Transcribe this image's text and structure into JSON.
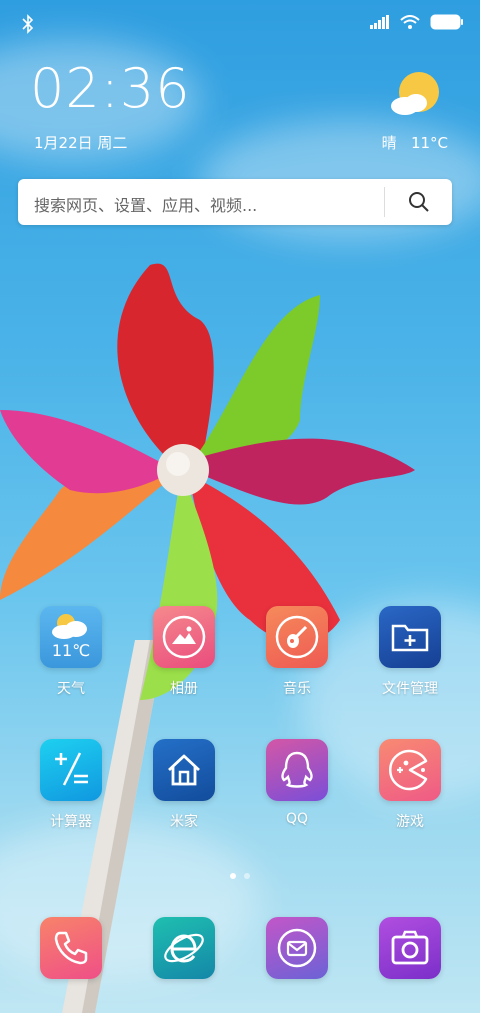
{
  "status_bar": {
    "bluetooth": "bluetooth-icon",
    "signal": "signal-icon",
    "wifi": "wifi-icon",
    "battery": "battery-icon"
  },
  "clock": {
    "time": "02:36",
    "date": "1月22日 周二"
  },
  "weather": {
    "condition": "晴",
    "temperature": "11°C",
    "icon": "sun-cloud-icon"
  },
  "search": {
    "placeholder": "搜索网页、设置、应用、视频..."
  },
  "apps_row1": [
    {
      "label": "天气",
      "icon": "weather-icon",
      "icon_text": "11℃",
      "color": "#4aa8e6"
    },
    {
      "label": "相册",
      "icon": "gallery-icon",
      "color": "#f0607c"
    },
    {
      "label": "音乐",
      "icon": "music-icon",
      "color": "#f26a56"
    },
    {
      "label": "文件管理",
      "icon": "folder-icon",
      "color": "#1e4fa8"
    }
  ],
  "apps_row2": [
    {
      "label": "计算器",
      "icon": "calculator-icon",
      "color": "#13a9e8"
    },
    {
      "label": "米家",
      "icon": "home-icon",
      "color": "#1a5fb6"
    },
    {
      "label": "QQ",
      "icon": "qq-icon",
      "color": "#9a4fd4"
    },
    {
      "label": "游戏",
      "icon": "game-icon",
      "color": "#f46a8a"
    }
  ],
  "page_indicator": {
    "pages": 2,
    "current": 1
  },
  "dock": [
    {
      "icon": "phone-icon",
      "color": "#f45f7f"
    },
    {
      "icon": "browser-icon",
      "color": "#19a6a6"
    },
    {
      "icon": "messages-icon",
      "color": "#9b4fcf"
    },
    {
      "icon": "camera-icon",
      "color": "#9a3ad6"
    }
  ]
}
